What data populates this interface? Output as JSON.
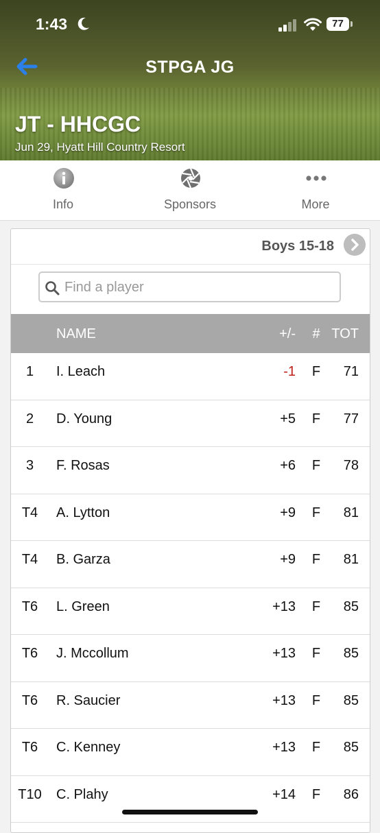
{
  "status_bar": {
    "time": "1:43",
    "battery": "77"
  },
  "nav": {
    "title": "STPGA JG"
  },
  "event": {
    "title": "JT - HHCGC",
    "subtitle": "Jun 29, Hyatt Hill Country Resort"
  },
  "tabs": [
    {
      "label": "Info",
      "icon": "info-icon"
    },
    {
      "label": "Sponsors",
      "icon": "aperture-icon"
    },
    {
      "label": "More",
      "icon": "ellipsis-icon"
    }
  ],
  "division": "Boys 15-18",
  "search": {
    "placeholder": "Find a player",
    "value": ""
  },
  "columns": {
    "name": "NAME",
    "plus_minus": "+/-",
    "hole": "#",
    "total": "TOT"
  },
  "accent": "#2a7fe8",
  "negative_color": "#c0201a",
  "players": [
    {
      "pos": "1",
      "name": "I. Leach",
      "pm": "-1",
      "hole": "F",
      "tot": "71"
    },
    {
      "pos": "2",
      "name": "D. Young",
      "pm": "+5",
      "hole": "F",
      "tot": "77"
    },
    {
      "pos": "3",
      "name": "F. Rosas",
      "pm": "+6",
      "hole": "F",
      "tot": "78"
    },
    {
      "pos": "T4",
      "name": "A. Lytton",
      "pm": "+9",
      "hole": "F",
      "tot": "81"
    },
    {
      "pos": "T4",
      "name": "B. Garza",
      "pm": "+9",
      "hole": "F",
      "tot": "81"
    },
    {
      "pos": "T6",
      "name": "L. Green",
      "pm": "+13",
      "hole": "F",
      "tot": "85"
    },
    {
      "pos": "T6",
      "name": "J. Mccollum",
      "pm": "+13",
      "hole": "F",
      "tot": "85"
    },
    {
      "pos": "T6",
      "name": "R. Saucier",
      "pm": "+13",
      "hole": "F",
      "tot": "85"
    },
    {
      "pos": "T6",
      "name": "C. Kenney",
      "pm": "+13",
      "hole": "F",
      "tot": "85"
    },
    {
      "pos": "T10",
      "name": "C. Plahy",
      "pm": "+14",
      "hole": "F",
      "tot": "86"
    }
  ]
}
